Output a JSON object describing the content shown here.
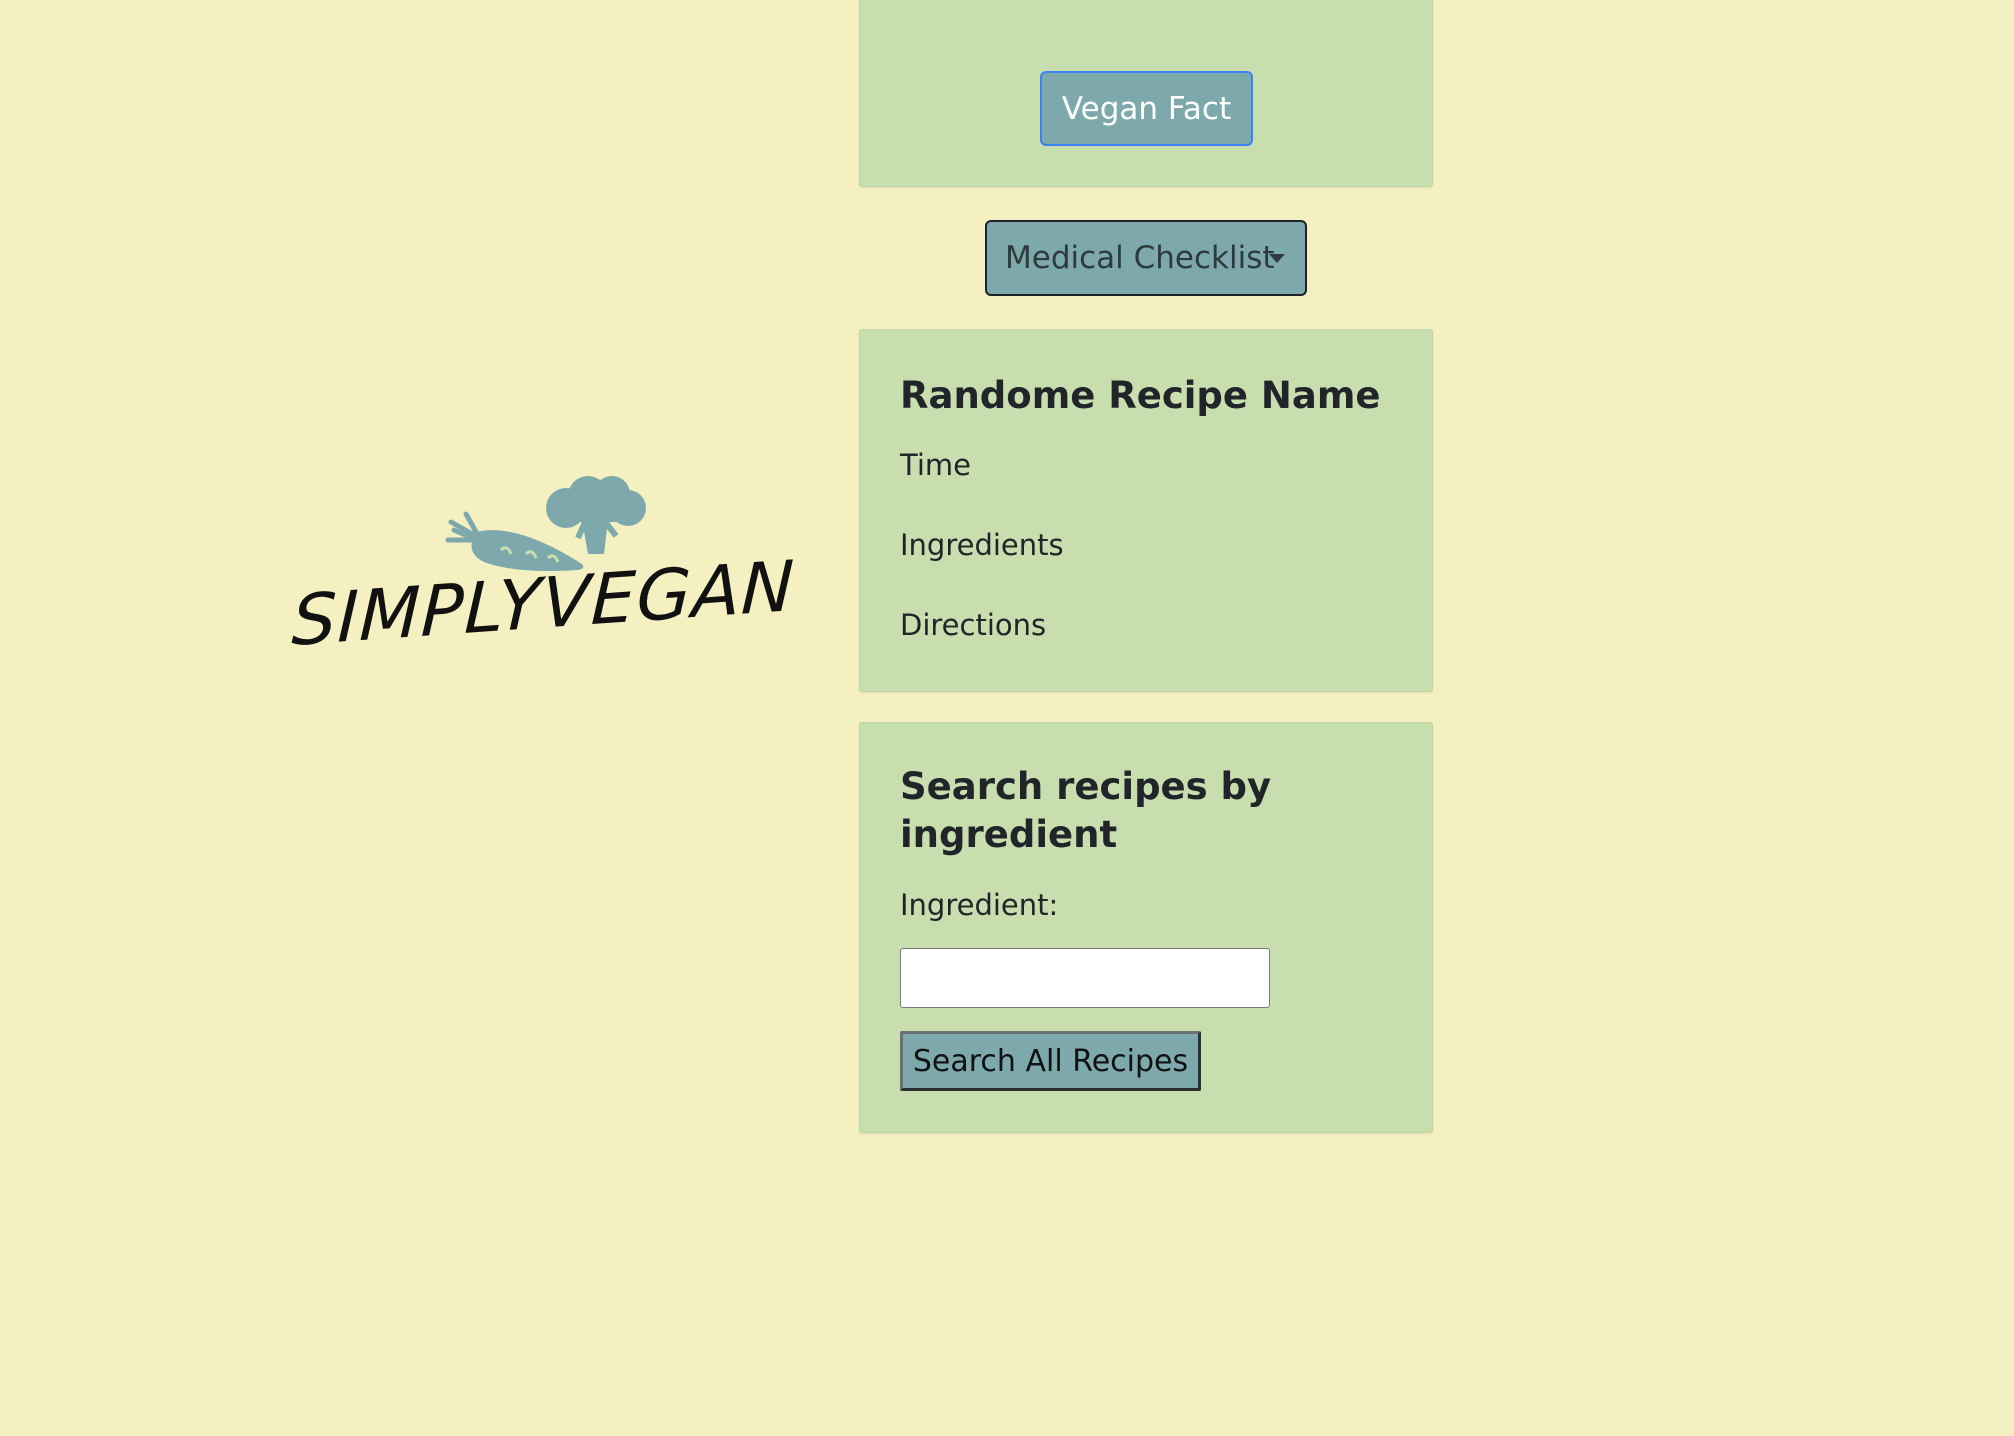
{
  "logo": {
    "text": "SIMPLYVEGAN",
    "icons": [
      "carrot-icon",
      "broccoli-icon"
    ]
  },
  "fact_card": {
    "button_label": "Vegan Fact"
  },
  "medical": {
    "button_label": "Medical Checklist"
  },
  "recipe_card": {
    "title": "Randome Recipe Name",
    "time_label": "Time",
    "ingredients_label": "Ingredients",
    "directions_label": "Directions"
  },
  "search_card": {
    "title": "Search recipes by ingredient",
    "ingredient_label": "Ingredient:",
    "ingredient_value": "",
    "button_label": "Search All Recipes"
  },
  "colors": {
    "page_background": "#f5f0c2",
    "card_background": "#c9deaf",
    "button_accent": "#7da9ad"
  }
}
